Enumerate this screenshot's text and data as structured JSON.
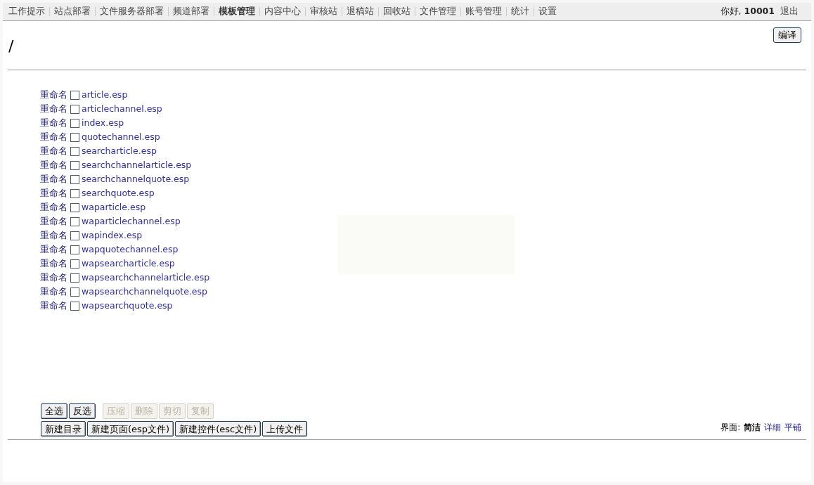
{
  "nav": [
    {
      "label": "工作提示",
      "selected": false
    },
    {
      "label": "站点部署",
      "selected": false
    },
    {
      "label": "文件服务器部署",
      "selected": false
    },
    {
      "label": "频道部署",
      "selected": false
    },
    {
      "label": "模板管理",
      "selected": true
    },
    {
      "label": "内容中心",
      "selected": false
    },
    {
      "label": "审核站",
      "selected": false
    },
    {
      "label": "退稿站",
      "selected": false
    },
    {
      "label": "回收站",
      "selected": false
    },
    {
      "label": "文件管理",
      "selected": false
    },
    {
      "label": "账号管理",
      "selected": false
    },
    {
      "label": "统计",
      "selected": false
    },
    {
      "label": "设置",
      "selected": false
    }
  ],
  "user": {
    "greeting": "你好,",
    "name": "10001",
    "logout": "退出"
  },
  "compile_button": "编译",
  "path": "/",
  "files": [
    {
      "rename": "重命名",
      "name": "article.esp",
      "checked": false
    },
    {
      "rename": "重命名",
      "name": "articlechannel.esp",
      "checked": false
    },
    {
      "rename": "重命名",
      "name": "index.esp",
      "checked": false
    },
    {
      "rename": "重命名",
      "name": "quotechannel.esp",
      "checked": false
    },
    {
      "rename": "重命名",
      "name": "searcharticle.esp",
      "checked": false
    },
    {
      "rename": "重命名",
      "name": "searchchannelarticle.esp",
      "checked": false
    },
    {
      "rename": "重命名",
      "name": "searchchannelquote.esp",
      "checked": false
    },
    {
      "rename": "重命名",
      "name": "searchquote.esp",
      "checked": false
    },
    {
      "rename": "重命名",
      "name": "waparticle.esp",
      "checked": false
    },
    {
      "rename": "重命名",
      "name": "waparticlechannel.esp",
      "checked": false
    },
    {
      "rename": "重命名",
      "name": "wapindex.esp",
      "checked": false
    },
    {
      "rename": "重命名",
      "name": "wapquotechannel.esp",
      "checked": false
    },
    {
      "rename": "重命名",
      "name": "wapsearcharticle.esp",
      "checked": false
    },
    {
      "rename": "重命名",
      "name": "wapsearchchannelarticle.esp",
      "checked": false
    },
    {
      "rename": "重命名",
      "name": "wapsearchchannelquote.esp",
      "checked": false
    },
    {
      "rename": "重命名",
      "name": "wapsearchquote.esp",
      "checked": false
    }
  ],
  "selection_buttons": [
    {
      "label": "全选",
      "disabled": false
    },
    {
      "label": "反选",
      "disabled": false
    },
    {
      "label": "压缩",
      "disabled": true
    },
    {
      "label": "删除",
      "disabled": true
    },
    {
      "label": "剪切",
      "disabled": true
    },
    {
      "label": "复制",
      "disabled": true
    }
  ],
  "create_buttons": [
    {
      "label": "新建目录",
      "disabled": false
    },
    {
      "label": "新建页面(esp文件)",
      "disabled": false
    },
    {
      "label": "新建控件(esc文件)",
      "disabled": false
    },
    {
      "label": "上传文件",
      "disabled": false
    }
  ],
  "view_mode": {
    "label": "界面:",
    "options": [
      {
        "label": "简洁",
        "selected": true
      },
      {
        "label": "详细",
        "selected": false
      },
      {
        "label": "平铺",
        "selected": false
      }
    ]
  }
}
